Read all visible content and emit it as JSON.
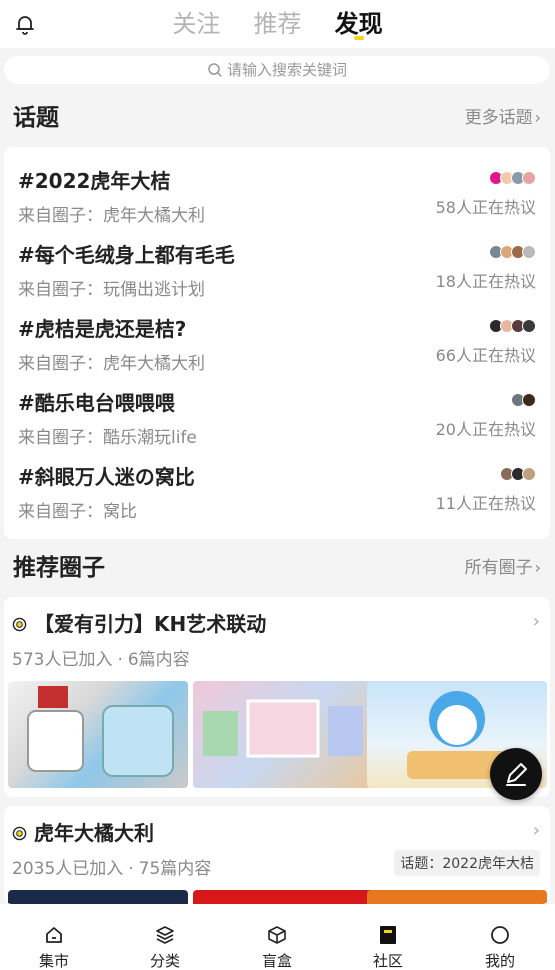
{
  "header": {
    "tabs": [
      {
        "label": "关注",
        "active": false
      },
      {
        "label": "推荐",
        "active": false
      },
      {
        "label": "发现",
        "active": true
      }
    ]
  },
  "search": {
    "placeholder": "请输入搜索关键词"
  },
  "topics_section": {
    "title": "话题",
    "more": "更多话题"
  },
  "topics": [
    {
      "title": "#2022虎年大桔",
      "source": "来自圈子：虎年大橘大利",
      "count": "58人正在热议",
      "avatar_colors": [
        "#e0168a",
        "#f3c9a8",
        "#8a9aa6",
        "#e7a3a3"
      ]
    },
    {
      "title": "#每个毛绒身上都有毛毛",
      "source": "来自圈子：玩偶出逃计划",
      "count": "18人正在热议",
      "avatar_colors": [
        "#7a8790",
        "#d9a77a",
        "#9c6a48",
        "#b9b9b9"
      ]
    },
    {
      "title": "#虎桔是虎还是桔?",
      "source": "来自圈子：虎年大橘大利",
      "count": "66人正在热议",
      "avatar_colors": [
        "#2a2a2a",
        "#e8b9a0",
        "#5a3a3a",
        "#3a3a3a"
      ]
    },
    {
      "title": "#酷乐电台喂喂喂",
      "source": "来自圈子：酷乐潮玩life",
      "count": "20人正在热议",
      "avatar_colors": [
        "#6a7680",
        "#3a2a1a"
      ]
    },
    {
      "title": "#斜眼万人迷の窝比",
      "source": "来自圈子：窝比",
      "count": "11人正在热议",
      "avatar_colors": [
        "#8a6a5a",
        "#2a2a2a",
        "#c0a080"
      ]
    }
  ],
  "circles_section": {
    "title": "推荐圈子",
    "more": "所有圈子"
  },
  "circles": [
    {
      "title": "【爱有引力】KH艺术联动",
      "members": "573人已加入",
      "posts": "6篇内容",
      "tag": ""
    },
    {
      "title": "虎年大橘大利",
      "members": "2035人已加入",
      "posts": "75篇内容",
      "tag": "话题：2022虎年大桔"
    }
  ],
  "bottom_nav": [
    {
      "label": "集市",
      "icon": "home-icon"
    },
    {
      "label": "分类",
      "icon": "layers-icon"
    },
    {
      "label": "盲盒",
      "icon": "box-icon"
    },
    {
      "label": "社区",
      "icon": "community-icon",
      "active": true
    },
    {
      "label": "我的",
      "icon": "profile-icon"
    }
  ],
  "colors": {
    "accent": "#f6d21a",
    "text": "#222222",
    "muted": "#8a8a8a",
    "background": "#f4f4f4"
  }
}
